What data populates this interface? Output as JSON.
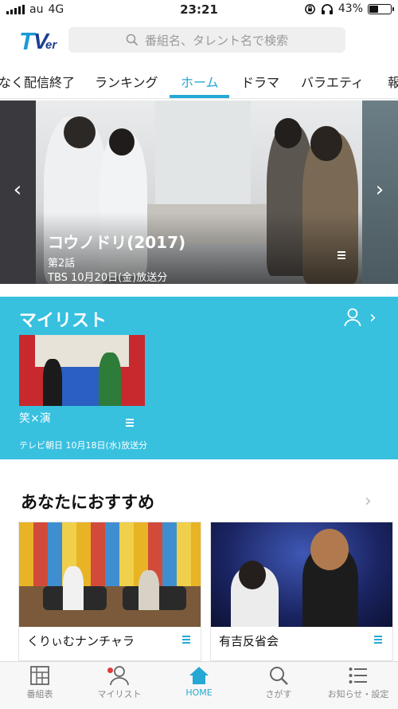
{
  "status_bar": {
    "carrier": "au",
    "network": "4G",
    "time": "23:21",
    "battery_percent": "43%",
    "battery_level": 0.43
  },
  "header": {
    "logo": "TVer",
    "search_placeholder": "番組名、タレント名で検索"
  },
  "tabs": [
    {
      "label": "なく配信終了"
    },
    {
      "label": "ランキング"
    },
    {
      "label": "ホーム",
      "active": true
    },
    {
      "label": "ドラマ"
    },
    {
      "label": "バラエティ"
    },
    {
      "label": "報"
    }
  ],
  "hero": {
    "title": "コウノドリ(2017)",
    "episode": "第2話",
    "broadcast": "TBS  10月20日(金)放送分"
  },
  "mylist": {
    "heading": "マイリスト",
    "card_title": "笑×演",
    "card_meta": "テレビ朝日  10月18日(水)放送分"
  },
  "recommend": {
    "heading": "あなたにおすすめ",
    "cards": [
      {
        "title": "くりぃむナンチャラ"
      },
      {
        "title": "有吉反省会"
      }
    ]
  },
  "bottom_nav": [
    {
      "label": "番組表",
      "icon": "schedule-icon"
    },
    {
      "label": "マイリスト",
      "icon": "person-icon"
    },
    {
      "label": "HOME",
      "icon": "home-icon",
      "active": true
    },
    {
      "label": "さがす",
      "icon": "search-icon"
    },
    {
      "label": "お知らせ・設定",
      "icon": "list-icon"
    }
  ],
  "colors": {
    "accent": "#26a8d4",
    "mylist_bg": "#38c0df",
    "logo_light": "#1a9bd6",
    "logo_dark": "#1b3f8f"
  }
}
